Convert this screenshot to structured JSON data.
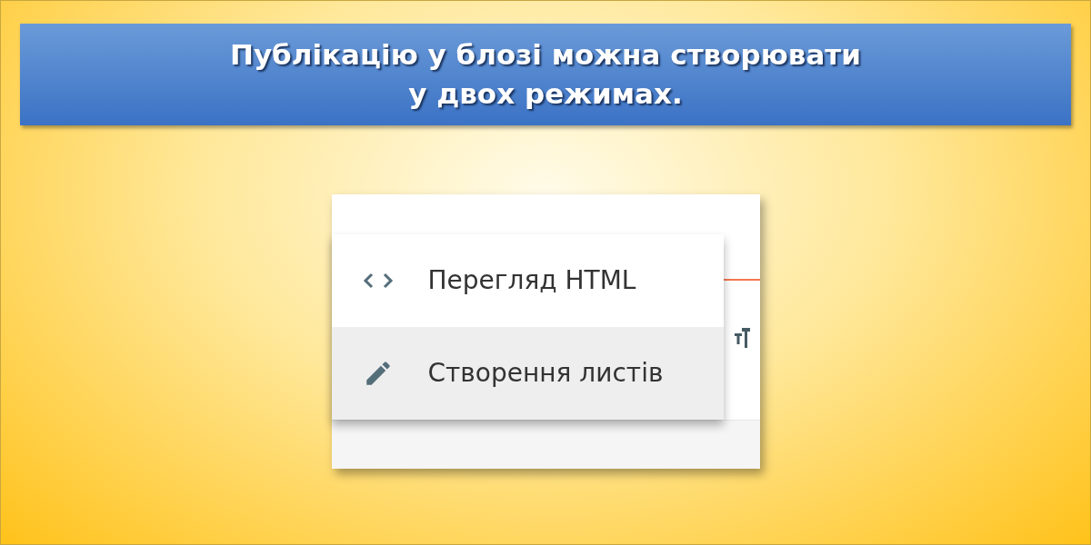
{
  "banner": {
    "title": "Публікацію у блозі можна створювати\nу двох режимах."
  },
  "menu": {
    "items": [
      {
        "kind": "code",
        "label": "Перегляд HTML",
        "selected": false
      },
      {
        "kind": "edit",
        "label": "Створення листів",
        "selected": true
      }
    ]
  }
}
